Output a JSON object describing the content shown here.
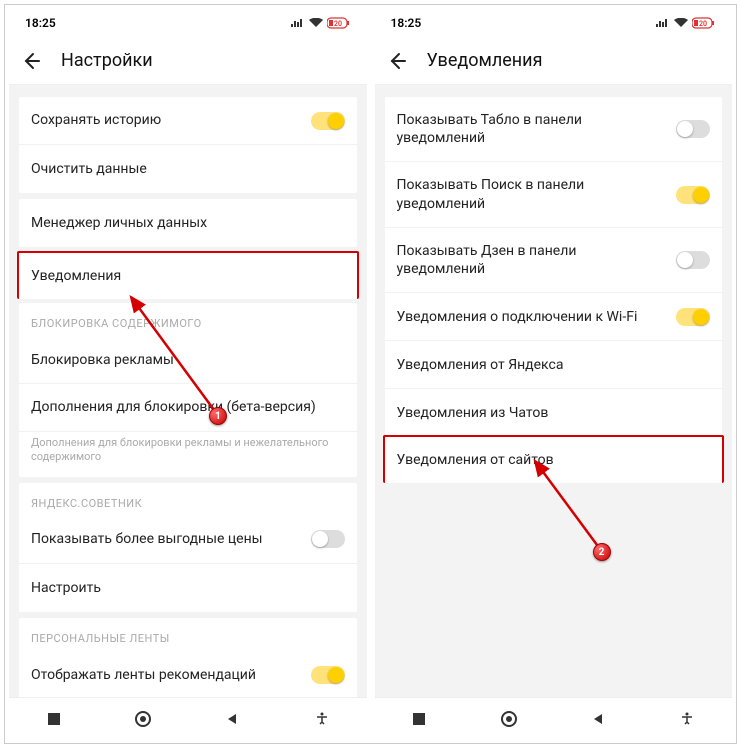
{
  "status": {
    "time": "18:25",
    "battery": "20"
  },
  "left": {
    "title": "Настройки",
    "rows": {
      "saveHistory": "Сохранять историю",
      "clearData": "Очистить данные",
      "personalDataMgr": "Менеджер личных данных",
      "notifications": "Уведомления",
      "sectionBlocking": "БЛОКИРОВКА СОДЕРЖИМОГО",
      "adBlock": "Блокировка рекламы",
      "addons": "Дополнения для блокировки (бета-версия)",
      "addonsHelper": "Дополнения для блокировки рекламы и нежелательного содержимого",
      "sectionAdvisor": "ЯНДЕКС.СОВЕТНИК",
      "betterPrices": "Показывать более выгодные цены",
      "configure": "Настроить",
      "sectionFeeds": "ПЕРСОНАЛЬНЫЕ ЛЕНТЫ",
      "showFeeds": "Отображать ленты рекомендаций"
    }
  },
  "right": {
    "title": "Уведомления",
    "rows": {
      "tablo": "Показывать Табло в панели уведомлений",
      "search": "Показывать Поиск в панели уведомлений",
      "zen": "Показывать Дзен в панели уведомлений",
      "wifi": "Уведомления о подключении к Wi-Fi",
      "fromYandex": "Уведомления от Яндекса",
      "fromChats": "Уведомления из Чатов",
      "fromSites": "Уведомления от сайтов"
    }
  },
  "markers": {
    "one": "1",
    "two": "2"
  }
}
